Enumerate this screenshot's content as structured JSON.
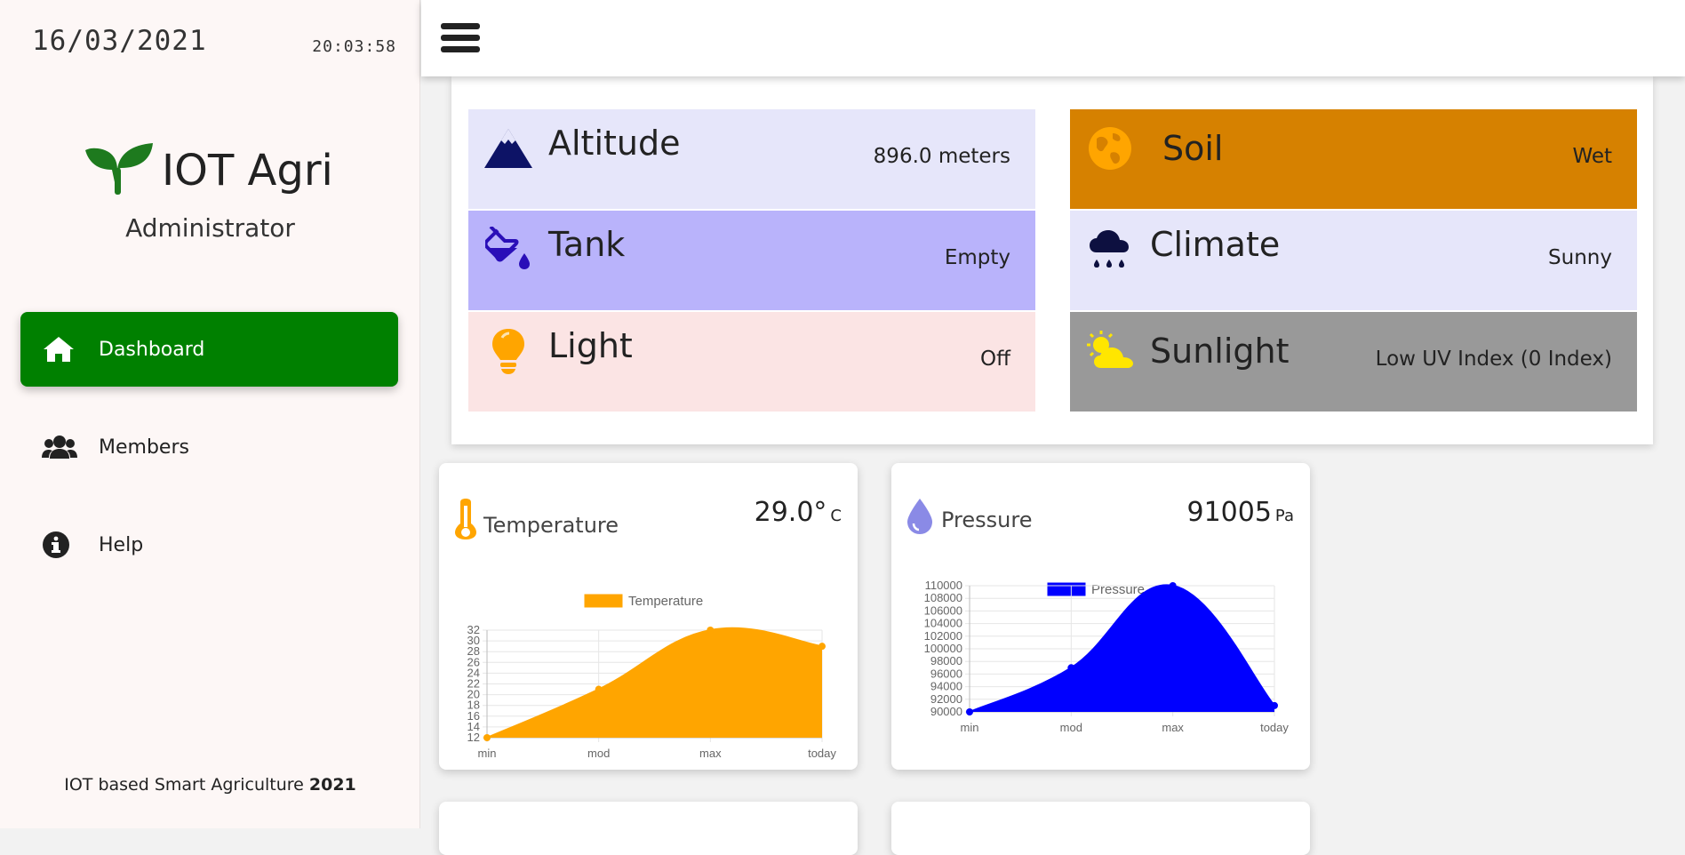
{
  "sidebar": {
    "date": "16/03/2021",
    "time": "20:03:58",
    "brand": "IOT Agri",
    "role": "Administrator",
    "nav": [
      {
        "label": "Dashboard",
        "icon": "home-icon"
      },
      {
        "label": "Members",
        "icon": "users-icon"
      },
      {
        "label": "Help",
        "icon": "info-icon"
      }
    ],
    "footer_text": "IOT based Smart Agriculture ",
    "footer_year": "2021"
  },
  "status": {
    "altitude": {
      "label": "Altitude",
      "value": "896.0 meters",
      "icon": "mountain-icon"
    },
    "tank": {
      "label": "Tank",
      "value": "Empty",
      "icon": "fill-drip-icon"
    },
    "light": {
      "label": "Light",
      "value": "Off",
      "icon": "lightbulb-icon"
    },
    "soil": {
      "label": "Soil",
      "value": "Wet",
      "icon": "globe-icon"
    },
    "climate": {
      "label": "Climate",
      "value": "Sunny",
      "icon": "cloud-rain-icon"
    },
    "sunlight": {
      "label": "Sunlight",
      "value": "Low UV Index (0 Index)",
      "icon": "sun-cloud-icon"
    }
  },
  "colors": {
    "accent_green": "#008000",
    "altitude_bg": "#e6e6fa",
    "tank_bg": "#b9b3fb",
    "light_bg": "#fbe4e4",
    "soil_bg": "#d68100",
    "climate_bg": "#e6e6fa",
    "sunlight_bg": "#999999",
    "temperature": "#ffa500",
    "pressure": "#0000ff"
  },
  "cards": {
    "temperature": {
      "title": "Temperature",
      "value": "29.0°",
      "unit": "C",
      "icon": "thermometer-icon"
    },
    "pressure": {
      "title": "Pressure",
      "value": "91005",
      "unit": "Pa",
      "icon": "droplet-icon"
    }
  },
  "chart_data": [
    {
      "type": "area",
      "categories": [
        "min",
        "mod",
        "max",
        "today"
      ],
      "series": [
        {
          "name": "Temperature",
          "values": [
            12,
            21,
            32,
            29
          ]
        }
      ],
      "yticks": [
        12,
        14,
        16,
        18,
        20,
        22,
        24,
        26,
        28,
        30,
        32
      ],
      "ylim": [
        12,
        32
      ],
      "legend": "top-center",
      "grid": true,
      "color": "#ffa500"
    },
    {
      "type": "area",
      "categories": [
        "min",
        "mod",
        "max",
        "today"
      ],
      "series": [
        {
          "name": "Pressure",
          "values": [
            90000,
            97000,
            110000,
            91005
          ]
        }
      ],
      "yticks": [
        90000,
        92000,
        94000,
        96000,
        98000,
        100000,
        102000,
        104000,
        106000,
        108000,
        110000
      ],
      "ylim": [
        90000,
        110000
      ],
      "legend": "top-center",
      "grid": true,
      "color": "#0000ff"
    }
  ]
}
